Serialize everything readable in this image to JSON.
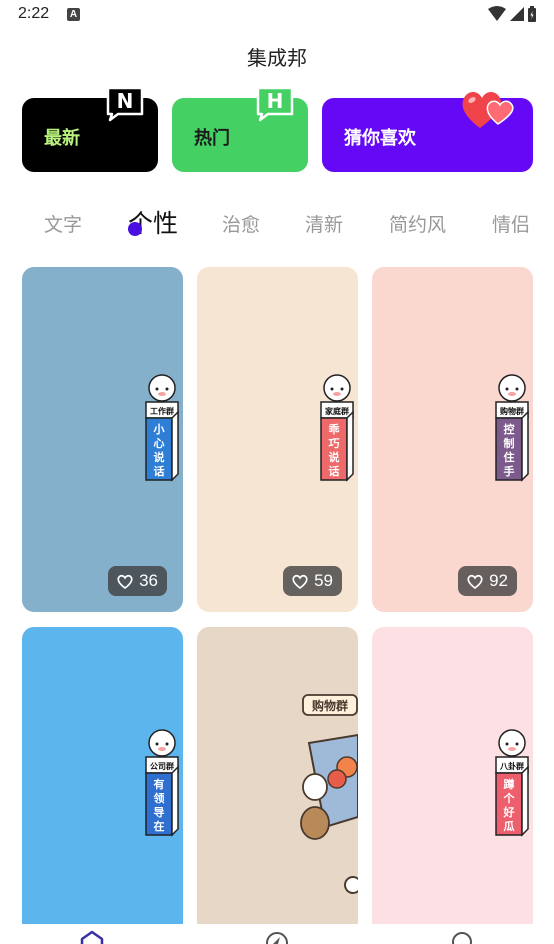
{
  "status": {
    "time": "2:22",
    "notif_letter": "A"
  },
  "app": {
    "title": "集成邦"
  },
  "categories": [
    {
      "label": "最新",
      "badge": "N"
    },
    {
      "label": "热门",
      "badge": "H"
    },
    {
      "label": "猜你喜欢"
    }
  ],
  "tabs": [
    "文字",
    "个性",
    "治愈",
    "清新",
    "简约风",
    "情侣"
  ],
  "active_tab": "个性",
  "wallpapers": [
    {
      "likes": "36",
      "bg": "#84b0cc",
      "tag": "工作群",
      "text": "小心说话",
      "body": "#2f7ed6"
    },
    {
      "likes": "59",
      "bg": "#f7e5d4",
      "tag": "家庭群",
      "text": "乖巧说话",
      "body": "#ee6a6a"
    },
    {
      "likes": "92",
      "bg": "#fad8d0",
      "tag": "购物群",
      "text": "控制住手",
      "body": "#7c5a8c"
    },
    {
      "bg": "#5db5ee",
      "tag": "公司群",
      "text": "有领导在",
      "body": "#2f6fd0"
    },
    {
      "bg": "#e6d7c6",
      "tag": "购物群"
    },
    {
      "bg": "#fde0e3",
      "tag": "八卦群",
      "text": "蹲个好瓜",
      "body": "#ee5f6e"
    }
  ],
  "colors": {
    "accent": "#6508f5",
    "hot": "#44d062",
    "newest_text": "#b8f27c"
  }
}
